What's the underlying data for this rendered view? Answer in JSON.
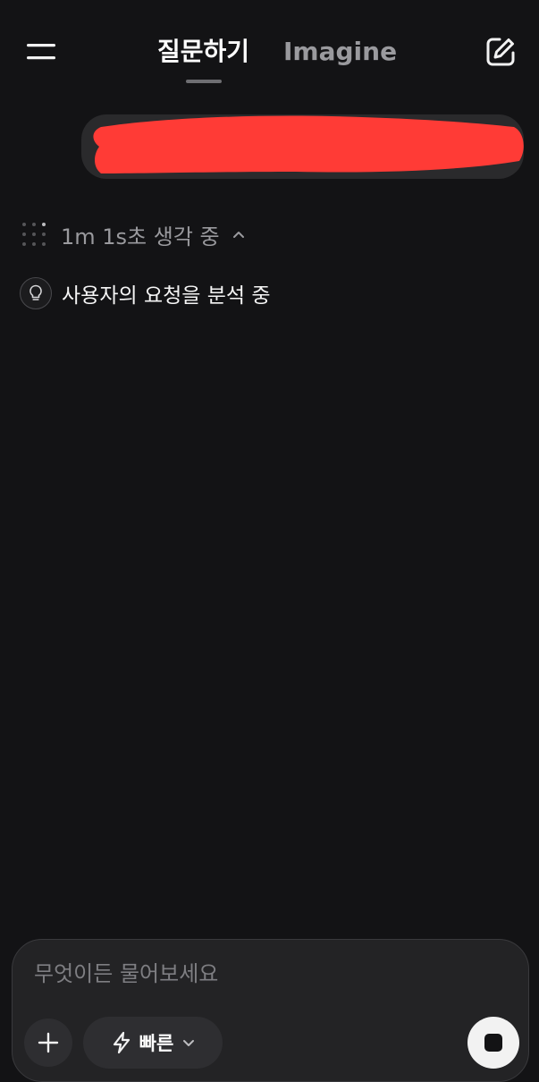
{
  "header": {
    "tabs": [
      {
        "label": "질문하기",
        "active": true
      },
      {
        "label": "Imagine",
        "active": false
      }
    ],
    "menu_icon": "menu-icon",
    "new_chat_icon": "compose-icon"
  },
  "conversation": {
    "user_message": {
      "redacted": true,
      "redaction_color": "#ff3b36"
    },
    "thinking": {
      "status_text": "1m 1s초 생각 중",
      "expanded": true,
      "icon": "dots-grid-icon"
    },
    "steps": [
      {
        "icon": "lightbulb-icon",
        "label": "사용자의 요청을 분석 중"
      }
    ]
  },
  "composer": {
    "placeholder": "무엇이든 물어보세요",
    "value": "",
    "mode_label": "빠른",
    "mode_icon": "lightning-icon",
    "attach_icon": "plus-icon",
    "stop_icon": "stop-icon"
  },
  "colors": {
    "background": "#131315",
    "bubble": "#2a2a2c",
    "composer": "#232325",
    "muted_text": "#9a9a9e",
    "redaction": "#ff3b36"
  }
}
